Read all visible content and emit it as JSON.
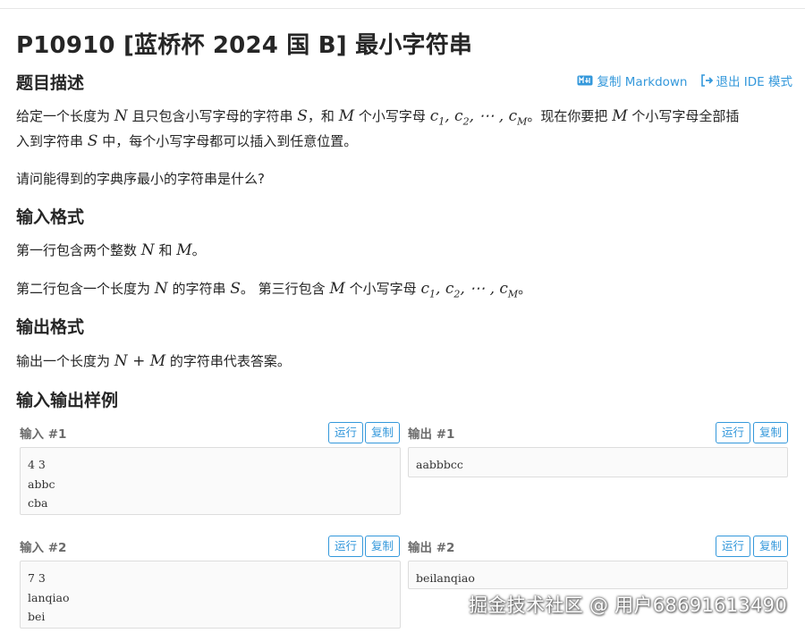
{
  "problem": {
    "title": "P10910 [蓝桥杯 2024 国 B] 最小字符串"
  },
  "toolbar": {
    "copy_markdown": "复制 Markdown",
    "exit_ide": "退出 IDE 模式"
  },
  "sections": {
    "description": "题目描述",
    "input_format": "输入格式",
    "output_format": "输出格式",
    "samples": "输入输出样例"
  },
  "description": {
    "l1_a": "给定一个长度为",
    "l1_b": "且只包含小写字母的字符串",
    "l1_c": "，和",
    "l1_d": "个小写字母",
    "l1_e": "。现在你要把",
    "l1_f": "个小写字母全部插",
    "l2_a": "入到字符串",
    "l2_b": "中，每个小写字母都可以插入到任意位置。",
    "q": "请问能得到的字典序最小的字符串是什么?"
  },
  "input_format": {
    "l1_a": "第一行包含两个整数",
    "l1_b": "和",
    "l1_c": "。",
    "l2_a": "第二行包含一个长度为",
    "l2_b": "的字符串",
    "l2_c": "。 第三行包含",
    "l2_d": "个小写字母",
    "l2_e": "。"
  },
  "output_format": {
    "l1_a": "输出一个长度为",
    "l1_b": "的字符串代表答案。"
  },
  "math": {
    "N": "N",
    "S": "S",
    "M": "M",
    "c": "c",
    "sub1": "1",
    "sub2": "2",
    "subM": "M",
    "comma": ",",
    "dots": "⋯",
    "NplusM": "N + M"
  },
  "samples": {
    "run": "运行",
    "copy": "复制",
    "in1_label": "输入 #1",
    "out1_label": "输出 #1",
    "in2_label": "输入 #2",
    "out2_label": "输出 #2",
    "in1": "4 3\nabbc\ncba",
    "out1": "aabbbcc",
    "in2": "7 3\nlanqiao\nbei",
    "out2": "beilanqiao"
  },
  "watermark": "掘金技术社区 @ 用户68691613490",
  "colors": {
    "accent": "#3498db",
    "text": "#262626"
  }
}
